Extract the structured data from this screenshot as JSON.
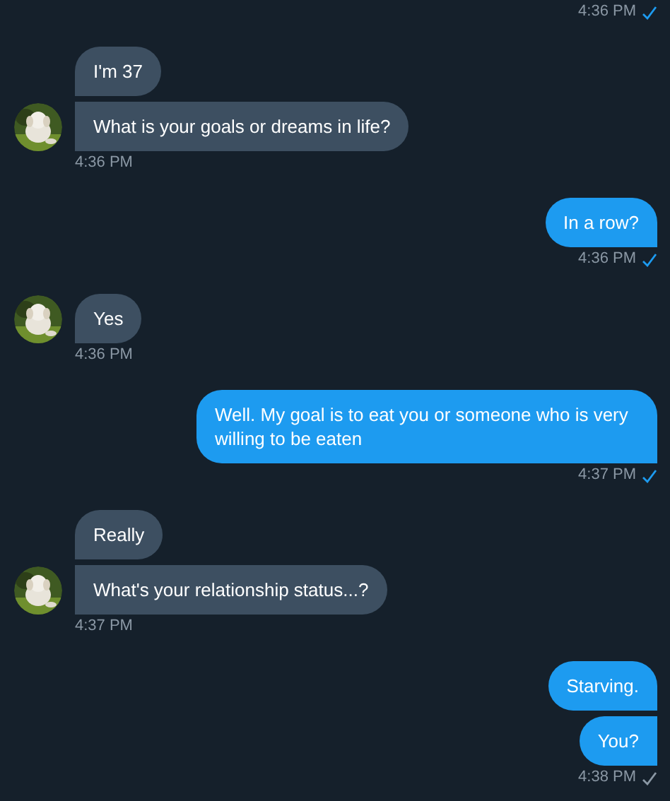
{
  "groups": [
    {
      "kind": "outgoing",
      "time": "4:36 PM",
      "read": true
    },
    {
      "kind": "incoming",
      "messages": [
        "I'm 37",
        "What is your goals or dreams in life?"
      ],
      "time": "4:36 PM"
    },
    {
      "kind": "outgoing",
      "messages": [
        "In a row?"
      ],
      "time": "4:36 PM",
      "read": true
    },
    {
      "kind": "incoming",
      "messages": [
        "Yes"
      ],
      "time": "4:36 PM"
    },
    {
      "kind": "outgoing",
      "messages": [
        "Well. My goal is to eat you or someone who is very willing to be eaten"
      ],
      "time": "4:37 PM",
      "read": true
    },
    {
      "kind": "incoming",
      "messages": [
        "Really",
        "What's your relationship status...?"
      ],
      "time": "4:37 PM"
    },
    {
      "kind": "outgoing",
      "messages": [
        "Starving.",
        "You?"
      ],
      "time": "4:38 PM",
      "read": false
    }
  ]
}
